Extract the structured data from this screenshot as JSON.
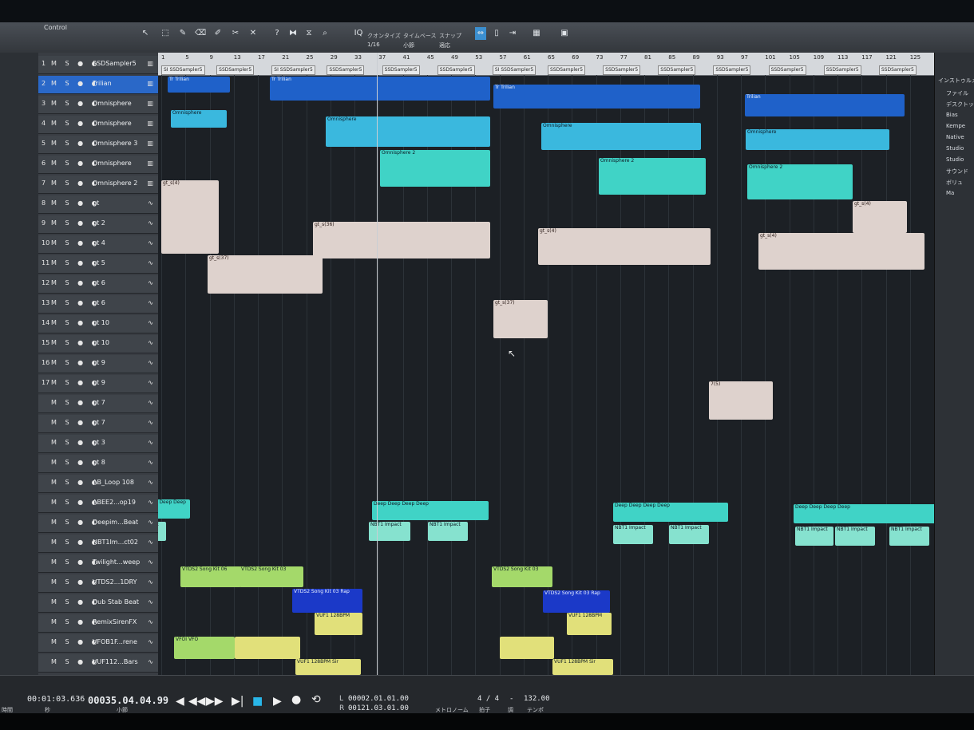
{
  "toolbar": {
    "control_label": "Control",
    "quantize_label": "クオンタイズ",
    "quantize_value": "1/16",
    "timebase_label": "タイムベース",
    "timebase_value": "小節",
    "snap_label": "スナップ",
    "snap_value": "適応"
  },
  "tracks": [
    {
      "num": "1",
      "name": "SSDSampler5"
    },
    {
      "num": "2",
      "name": "Trilian"
    },
    {
      "num": "3",
      "name": "Omnisphere"
    },
    {
      "num": "4",
      "name": "Omnisphere"
    },
    {
      "num": "5",
      "name": "Omnisphere 3"
    },
    {
      "num": "6",
      "name": "Omnisphere"
    },
    {
      "num": "7",
      "name": "Omnisphere 2"
    },
    {
      "num": "8",
      "name": "gt"
    },
    {
      "num": "9",
      "name": "gt 2"
    },
    {
      "num": "10",
      "name": "gt 4"
    },
    {
      "num": "11",
      "name": "gt 5"
    },
    {
      "num": "12",
      "name": "gt 6"
    },
    {
      "num": "13",
      "name": "gt 6"
    },
    {
      "num": "14",
      "name": "gt 10"
    },
    {
      "num": "15",
      "name": "gt 10"
    },
    {
      "num": "16",
      "name": "gt 9"
    },
    {
      "num": "17",
      "name": "gt 9"
    },
    {
      "num": "",
      "name": "gt 7"
    },
    {
      "num": "",
      "name": "gt 7"
    },
    {
      "num": "",
      "name": "gt 3"
    },
    {
      "num": "",
      "name": "gt 8"
    },
    {
      "num": "",
      "name": "AB_Loop 108"
    },
    {
      "num": "",
      "name": "ABEE2...op19"
    },
    {
      "num": "",
      "name": "Deepim...Beat"
    },
    {
      "num": "",
      "name": "NBT1Im...ct02"
    },
    {
      "num": "",
      "name": "Twilight...weep"
    },
    {
      "num": "",
      "name": "VTDS2...1DRY"
    },
    {
      "num": "",
      "name": "Dub Stab Beat"
    },
    {
      "num": "",
      "name": "RemixSirenFX"
    },
    {
      "num": "",
      "name": "VFOB1F...rene"
    },
    {
      "num": "",
      "name": "VUF112...Bars"
    }
  ],
  "ruler": {
    "bars": [
      "1",
      "5",
      "9",
      "13",
      "17",
      "21",
      "25",
      "29",
      "33",
      "37",
      "41",
      "45",
      "49",
      "53",
      "57",
      "61",
      "65",
      "69",
      "73",
      "77",
      "81",
      "85",
      "89",
      "93",
      "97",
      "101",
      "105",
      "109",
      "113",
      "117",
      "121",
      "125"
    ]
  },
  "markers": [
    "SI SSDSampler5",
    "SSDSampler5",
    "SI SSDSampler5",
    "SSDSampler5",
    "SSDSampler5",
    "SSDSampler5",
    "SI SSDSampler5",
    "SSDSampler5",
    "SSDSampler5",
    "SSDSampler5",
    "SSDSampler5",
    "SSDSampler5",
    "SSDSampler5",
    "SSDSampler5"
  ],
  "clips": {
    "trilian": "Trilian",
    "tr_trilian": "Tr Trilian",
    "omnisphere": "Omnisphere",
    "omnisphere2": "Omnisphere 2",
    "deep": "Deep Deep Deep Deep",
    "nbt": "NBT1 Impact",
    "vtds2_a": "VTDS2 Song Kit 06",
    "vtds2_b": "VTDS2 Song Kit 03",
    "vtds2_rap": "VTDS2 Song Kit 03 Rap",
    "vuf128": "VUF1 128BPM",
    "vuf128_sir": "VUF1 128BPM Sir",
    "vfo": "VFOI VFO",
    "gt_s4": "gt_s(4)",
    "gt_s36": "gt_s(36)",
    "gt_s37": "gt_s(37)",
    "gt_7s": "7(5)"
  },
  "browser": {
    "header": "インストゥルメント",
    "items": [
      "ファイル",
      "デスクトップ",
      "Bias",
      "Kempe",
      "Native",
      "Studio",
      "Studio",
      "サウンド",
      "ボリュ",
      "Ma"
    ]
  },
  "transport": {
    "time": "00:01:03.636",
    "time_label": "時間",
    "sec_label": "秒",
    "bars": "00035.04.04.99",
    "bars_label": "小節",
    "loop_l": "00002.01.01.00",
    "loop_r": "00121.03.01.00",
    "l_label": "L",
    "r_label": "R",
    "signature": "4 / 4",
    "signature_label": "拍子",
    "key_value": "-",
    "key_label": "調",
    "tempo": "132.00",
    "tempo_label": "テンポ",
    "metronome_label": "メトロノーム"
  },
  "colors": {
    "trilian": "#1f61c9",
    "omnisphere": "#3ab8de",
    "audio": "#ded2cd",
    "deep": "#40d3c6",
    "vtds": "#a4d96a",
    "vuf": "#e1e07a"
  }
}
